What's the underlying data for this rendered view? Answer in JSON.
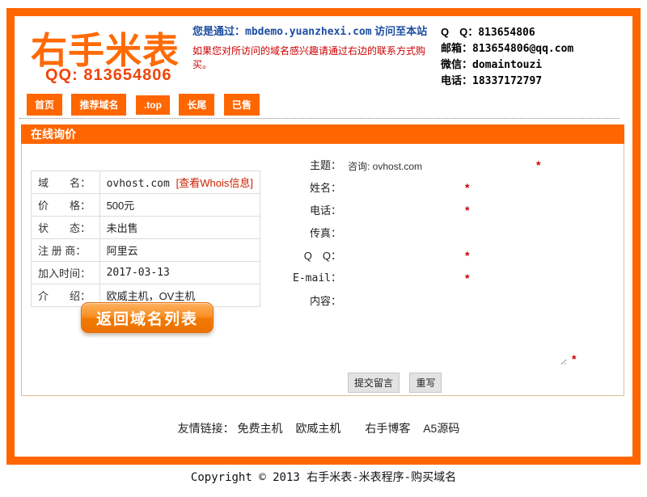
{
  "colors": {
    "accent_orange": "#FF6600",
    "logo_orange": "#FF6A05",
    "qq_red_orange": "#ED4509",
    "notice_blue": "#1D4EA1",
    "warning_red": "#CC0000",
    "box_border": "#E1BE94",
    "table_border": "#DCDCDC"
  },
  "header": {
    "logo": "右手米表",
    "logo_qq": "QQ: 813654806",
    "notice_prefix": "您是通过：",
    "notice_domain": "mbdemo.yuanzhexi.com",
    "notice_suffix": " 访问至本站",
    "hint": "如果您对所访问的域名感兴趣请通过右边的联系方式购买。",
    "contacts": [
      {
        "label": "Q　Q：",
        "value": "813654806"
      },
      {
        "label": "邮箱：",
        "value": "813654806@qq.com"
      },
      {
        "label": "微信：",
        "value": "domaintouzi"
      },
      {
        "label": "电话：",
        "value": "18337172797"
      }
    ]
  },
  "nav": {
    "items": [
      {
        "label": "首页"
      },
      {
        "label": "推荐域名"
      },
      {
        "label": ".top"
      },
      {
        "label": "长尾"
      },
      {
        "label": "已售"
      }
    ]
  },
  "section": {
    "title": "在线询价"
  },
  "domain_info": {
    "rows": [
      {
        "label": "域　　名：",
        "value": "ovhost.com ",
        "link": "[查看Whois信息]"
      },
      {
        "label": "价　　格：",
        "value": "500元"
      },
      {
        "label": "状　　态：",
        "value": "未出售"
      },
      {
        "label": "注 册 商：",
        "value": "阿里云"
      },
      {
        "label": "加入时间：",
        "value": "2017-03-13"
      },
      {
        "label": "介　　绍：",
        "value": "欧威主机，OV主机"
      }
    ],
    "back_button": "返回域名列表"
  },
  "form": {
    "required_marker": "*",
    "fields": [
      {
        "label": "主题：",
        "value": "咨询: ovhost.com",
        "required": true
      },
      {
        "label": "姓名：",
        "value": "",
        "required": true
      },
      {
        "label": "电话：",
        "value": "",
        "required": true
      },
      {
        "label": "传真：",
        "value": "",
        "required": false
      },
      {
        "label": "Q　Q：",
        "value": "",
        "required": true
      },
      {
        "label": "E-mail：",
        "value": "",
        "required": true
      },
      {
        "label": "内容：",
        "value": "",
        "required": true
      }
    ],
    "submit_label": "提交留言",
    "reset_label": "重写"
  },
  "footer": {
    "links_label": "友情链接：",
    "links": [
      "免费主机",
      "欧威主机",
      "右手博客",
      "A5源码"
    ],
    "copyright": "Copyright © 2013 右手米表-米表程序-购买域名"
  }
}
